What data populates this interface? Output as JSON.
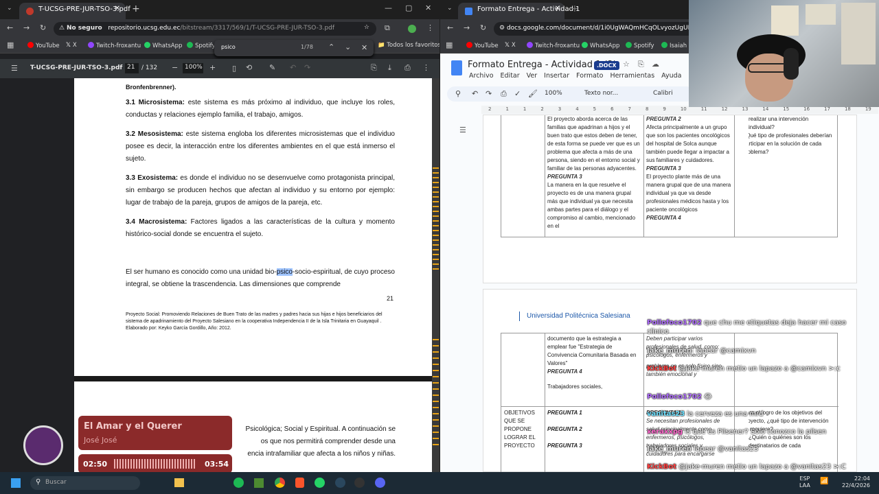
{
  "left_browser": {
    "tab_title": "T-UCSG-PRE-JUR-TSO-3.pdf",
    "security": "No seguro",
    "url_host": "repositorio.ucsg.edu.ec",
    "url_path": "/bitstream/3317/569/1/T-UCSG-PRE-JUR-TSO-3.pdf",
    "bookmarks": [
      "YouTube",
      "X",
      "Twitch-froxantu",
      "WhatsApp",
      "Spotify"
    ],
    "all_bookmarks": "Todos los favoritos",
    "find": {
      "query": "psico",
      "count": "1/78"
    },
    "pdf": {
      "title": "T-UCSG-PRE-JUR-TSO-3.pdf",
      "page": "21",
      "total": "/ 132",
      "zoom": "100%"
    }
  },
  "document": {
    "top_fragment": "Bronfenbrenner).",
    "items": [
      {
        "head": "3.1 Microsistema:",
        "text": " este sistema es más próximo al individuo, que incluye los roles, conductas y relaciones ejemplo familia, el trabajo, amigos."
      },
      {
        "head": "3.2 Mesosistema:",
        "text": " este sistema engloba los diferentes microsistemas que el individuo posee es decir, la interacción entre los diferentes ambientes en el que está inmerso el sujeto."
      },
      {
        "head": "3.3 Exosistema:",
        "text": " es donde el individuo no se desenvuelve como protagonista principal, sin embargo se producen hechos que afectan al individuo y su entorno por ejemplo: lugar de trabajo de la pareja, grupos de amigos de la pareja, etc."
      },
      {
        "head": "3.4 Macrosistema:",
        "text": " Factores ligados a las características de la cultura y momento histórico-social donde se encuentra el sujeto."
      }
    ],
    "para_before": "El ser humano es conocido como una unidad bio-",
    "para_hl": "psico",
    "para_after": "-socio-espiritual, de cuyo proceso integral, se obtiene la trascendencia. Las dimensiones que comprende",
    "page_number": "21",
    "footnote": "Proyecto Social: Promoviendo Relaciones de Buen Trato de las madres y padres hacia sus hijas e hijos beneficiarios del sistema de apadrinamiento del Proyecto Salesiano en la cooperativa Independencia II de la Isla Trinitaria en Guayaquil . Elaborado por: Keyko García Gordillo, Año: 2012.",
    "next_line1": "Psicológica; Social y Espiritual.  A continuación se",
    "next_line2": "os que nos permitirá comprender desde una",
    "next_line3": "encia intrafamiliar que afecta a los niños y niñas."
  },
  "music": {
    "title": "El Amar y el Querer",
    "artist": "José José",
    "elapsed": "02:50",
    "total": "03:54"
  },
  "right_browser": {
    "tab_title": "Formato Entrega - Actividad 1",
    "url": "docs.google.com/document/d/1i0UgWAQmHCqOLvyozUgUB",
    "bookmarks": [
      "YouTube",
      "X",
      "Twitch-froxantu",
      "WhatsApp",
      "Spotify",
      "Isaiah"
    ],
    "gdoc": {
      "title": "Formato Entrega - Actividad 1 (2)",
      "badge": ".DOCX",
      "menus": [
        "Archivo",
        "Editar",
        "Ver",
        "Insertar",
        "Formato",
        "Herramientas",
        "Ayuda"
      ],
      "zoom": "100%",
      "style": "Texto nor...",
      "font": "Calibri"
    },
    "ruler": [
      "2",
      "1",
      "1",
      "2",
      "3",
      "4",
      "5",
      "6",
      "7",
      "8",
      "9",
      "10",
      "11",
      "12",
      "13",
      "14",
      "15",
      "16",
      "17",
      "18",
      "19"
    ],
    "table1": {
      "col1": "El proyecto aborda acerca de las familias que apadrinan a hijos y el buen trato que estos deben de tener, de esta forma se puede ver que es un problema que afecta a más de una persona, siendo en el entorno social y familiar de las personas adyacentes.",
      "col1_q3": "PREGUNTA 3",
      "col1_b": "La manera en la que resuelve el proyecto es de una manera grupal más que individual ya que necesita ambas partes para el diálogo y el compromiso al cambio, mencionado en el",
      "col2_q2": "PREGUNTA 2",
      "col2_a": "Afecta principalmente a un grupo que son los pacientes oncológicos del hospital de Solca aunque también puede llegar a impactar a sus familiares y cuidadores.",
      "col2_q3": "PREGUNTA 3",
      "col2_b": "El proyecto plante más de una manera grupal que de una manera individual ya que va desde profesionales médicos hasta y los paciente oncológicos",
      "col2_q4": "PREGUNTA 4",
      "col3_a": "realizar una intervención individual?",
      "col3_num": "4.",
      "col3_b": "¿Qué tipo de profesionales deberían participar en la solución de cada problema?"
    },
    "header_text": "Universidad Politécnica Salesiana",
    "table2": {
      "col1_a": "documento que la estrategia a emplear fue \"Estrategia de Convivencia Comunitaria Basada en Valores\"",
      "q4": "PREGUNTA 4",
      "col1_b": "Trabajadores sociales,",
      "row_label": "OBJETIVOS QUE SE PROPONE LOGRAR EL PROYECTO",
      "q1": "PREGUNTA 1",
      "q2": "PREGUNTA 2",
      "q3": "PREGUNTA 3",
      "col2_a": "Deben participar varios profesionales de salud, como: psicólogos, enfermeros y",
      "col2_b": "problema no es solo físico sino también emocional y",
      "col2_c": "PREGUNTA 1",
      "col2_d": "Se necesitan profesionales de salud principalmente como enfermeros, psicólogos, trabajadores sociales y",
      "col2_e": "cuidadores para encargarse",
      "col3_num": "1.",
      "col3_a": "Para el logro de los objetivos del proyecto, ¿qué tipo de intervención se requiere?",
      "col3_b": "¿Quién o quiénes son los destinatarios de cada"
    }
  },
  "chat": [
    {
      "user": "Pollofoco1702",
      "msg": " que chu me etiquetas deja hacer mi caso clinico",
      "color": "#b06cff"
    },
    {
      "user": "Jake_muren",
      "msg": ": lapear @camixvn",
      "color": "#dddddd"
    },
    {
      "user": "KickBot",
      "msg": " @jake-muren metio un lapazo a @camixvn >:c",
      "color": "#ff4040"
    },
    {
      "user": "Pollofoco1702",
      "msg": " 😂",
      "color": "#b06cff"
    },
    {
      "user": "vanitas23",
      "msg": " la cerveza es una mrd",
      "color": "#6ce0ff"
    },
    {
      "user": "xeraxxpg",
      "msg": " ls que es Pilsener? Solo conozco la pilsen",
      "color": "#ff66cc"
    },
    {
      "user": "Jake_muren",
      "msg": " lapear @vanitas23",
      "color": "#dddddd"
    },
    {
      "user": "KickBot",
      "msg": " @jake-muren metio un lapazo a @vanitas23 >:C",
      "color": "#ff4040"
    }
  ],
  "taskbar": {
    "search": "Buscar",
    "lang1": "ESP",
    "lang2": "LAA",
    "time": "22:04",
    "date": "22/4/2026"
  }
}
